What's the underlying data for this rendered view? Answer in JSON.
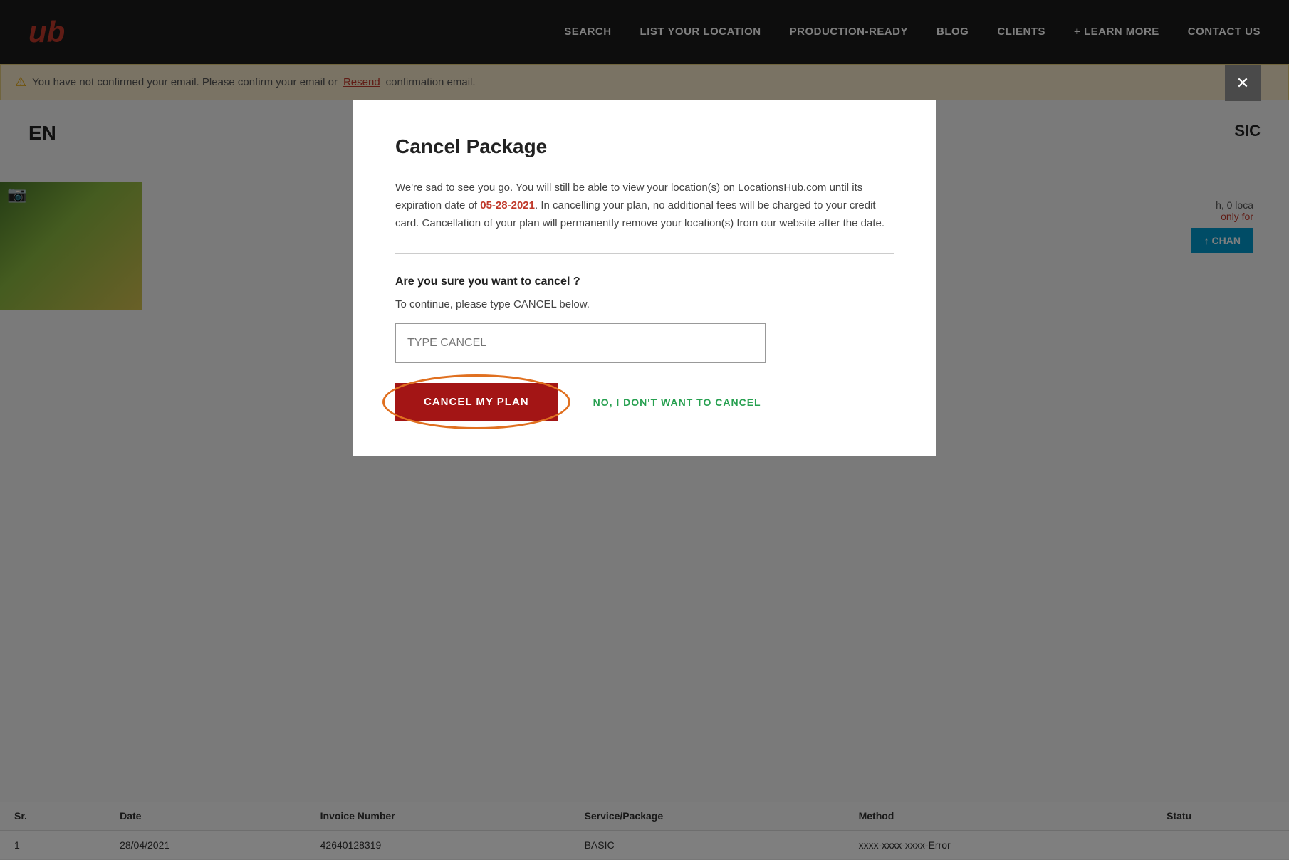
{
  "navbar": {
    "logo": "ub",
    "links": [
      {
        "label": "SEARCH",
        "id": "search"
      },
      {
        "label": "LIST YOUR LOCATION",
        "id": "list-location"
      },
      {
        "label": "PRODUCTION-READY",
        "id": "production-ready"
      },
      {
        "label": "BLOG",
        "id": "blog"
      },
      {
        "label": "CLIENTS",
        "id": "clients"
      },
      {
        "label": "+ LEARN MORE",
        "id": "learn-more"
      },
      {
        "label": "CONTACT US",
        "id": "contact-us"
      }
    ]
  },
  "close_button_label": "✕",
  "email_banner": {
    "warning": "⚠",
    "text_before": "You have not confirmed your email. Please confirm your email or ",
    "resend_link": "Resend",
    "text_after": " confirmation email."
  },
  "bg_content": {
    "title": "EN",
    "right_label": "SIC",
    "right_info_line1": "h, 0 loca",
    "right_only_for": "only for",
    "change_btn": "↑ CHAN"
  },
  "table": {
    "headers": [
      "Sr.",
      "Date",
      "Invoice Number",
      "Service/Package",
      "Method",
      "Statu"
    ],
    "rows": [
      {
        "sr": "1",
        "date": "28/04/2021",
        "invoice": "42640128319",
        "package": "BASIC",
        "method": "xxxx-xxxx-xxxx-Error",
        "status": ""
      }
    ]
  },
  "modal": {
    "title": "Cancel Package",
    "body_text_before": "We're sad to see you go. You will still be able to view your location(s) on LocationsHub.com until its expiration date of ",
    "expiry_date": "05-28-2021",
    "body_text_after": ". In cancelling your plan, no additional fees will be charged to your credit card. Cancellation of your plan will permanently remove your location(s) from our website after the date.",
    "question": "Are you sure you want to cancel ?",
    "instruction": "To continue, please type CANCEL below.",
    "input_placeholder": "TYPE CANCEL",
    "cancel_plan_btn": "CANCEL MY PLAN",
    "no_cancel_btn": "NO, I DON'T WANT TO CANCEL"
  }
}
